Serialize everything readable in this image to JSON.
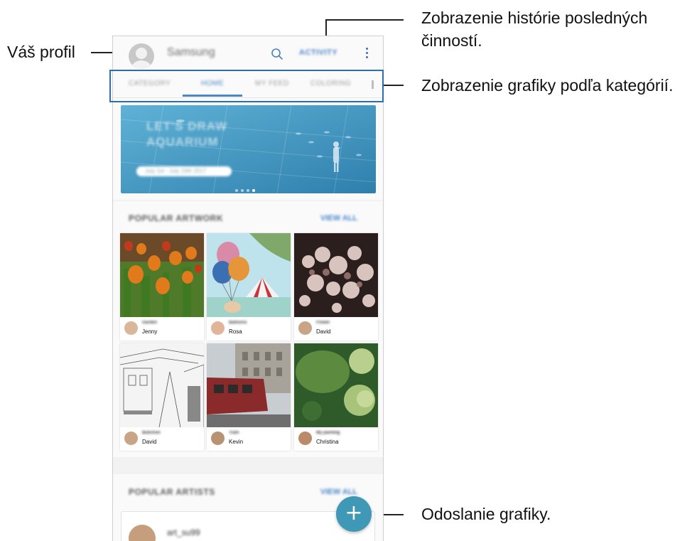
{
  "callouts": {
    "profile": "Váš profil",
    "activity_line1": "Zobrazenie histórie posledných",
    "activity_line2": "činností.",
    "categories": "Zobrazenie grafiky podľa kategórií.",
    "upload": "Odoslanie grafiky."
  },
  "appbar": {
    "account_name": "Samsung",
    "activity_label": "ACTIVITY",
    "icons": [
      "avatar",
      "search-icon",
      "more-options-icon"
    ]
  },
  "tabs": {
    "items": [
      "CATEGORY",
      "HOME",
      "MY FEED",
      "COLORING"
    ],
    "active": "HOME"
  },
  "banner": {
    "title_line1": "LET'S DRAW",
    "title_line2": "AQUARIUM",
    "date_range": "July 1st - July 16th 2017",
    "page_count": 4,
    "current_page": 4
  },
  "popular_artwork": {
    "title": "POPULAR ARTWORK",
    "link": "VIEW ALL",
    "cards": [
      {
        "title": "Garden",
        "author": "Jenny"
      },
      {
        "title": "Balloons",
        "author": "Rosa"
      },
      {
        "title": "Flower",
        "author": "David"
      },
      {
        "title": "Bukchon",
        "author": "David"
      },
      {
        "title": "Tram",
        "author": "Kevin"
      },
      {
        "title": "My painting",
        "author": "Christina"
      }
    ]
  },
  "popular_artists": {
    "title": "POPULAR ARTISTS",
    "link": "VIEW ALL",
    "first_artist": "art_su99"
  },
  "fab": {
    "symbol": "+",
    "icon": "add-icon"
  },
  "colors": {
    "accent": "#4b86c7",
    "fab": "#4098b7",
    "highlight_box": "#2a6fae",
    "banner": "#3e8fba"
  }
}
